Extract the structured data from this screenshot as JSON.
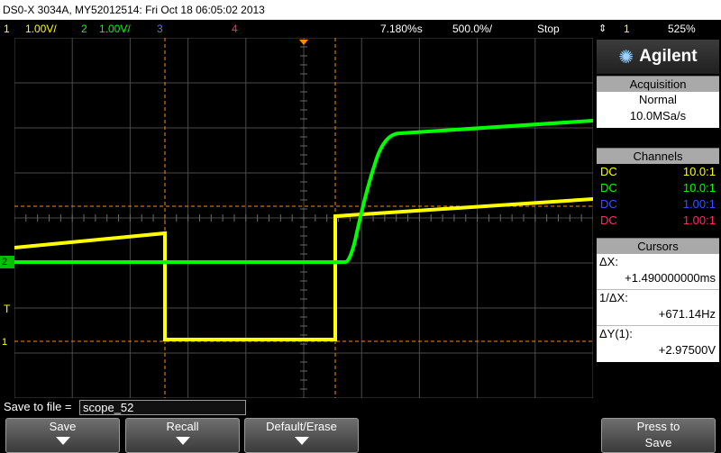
{
  "title": "DS0-X 3034A, MY52012514: Fri Oct 18 06:05:02 2013",
  "top": {
    "ch1_num": "1",
    "ch1_scale": "1.00V/",
    "ch2_num": "2",
    "ch2_scale": "1.00V/",
    "ch3_num": "3",
    "ch4_num": "4",
    "delay": "7.180%s",
    "timebase": "500.0%/",
    "state": "Stop",
    "trig_src": "1",
    "trig_level": "525%"
  },
  "brand": "Agilent",
  "acquisition": {
    "header": "Acquisition",
    "mode": "Normal",
    "rate": "10.0MSa/s"
  },
  "channels": {
    "header": "Channels",
    "rows": [
      {
        "coupling": "DC",
        "probe": "10.0:1",
        "color": "#ffff00"
      },
      {
        "coupling": "DC",
        "probe": "10.0:1",
        "color": "#00ff00"
      },
      {
        "coupling": "DC",
        "probe": "1.00:1",
        "color": "#3355ff"
      },
      {
        "coupling": "DC",
        "probe": "1.00:1",
        "color": "#ff2a6a"
      }
    ]
  },
  "cursors": {
    "header": "Cursors",
    "dx_label": "ΔX:",
    "dx_value": "+1.490000000ms",
    "inv_label": "1/ΔX:",
    "inv_value": "+671.14Hz",
    "dy_label": "ΔY(1):",
    "dy_value": "+2.97500V"
  },
  "markers": {
    "ch2": "2",
    "trig": "T",
    "ch1": "1"
  },
  "save": {
    "label": "Save to file =",
    "filename": "scope_52"
  },
  "softkeys": {
    "save": "Save",
    "recall": "Recall",
    "default_erase": "Default/Erase",
    "press_to": "Press to",
    "press_save": "Save"
  },
  "colors": {
    "ch1": "#ffff00",
    "ch2": "#00ff00",
    "ch3": "#3355ff",
    "ch4": "#ff2a6a",
    "cursor": "#ff8c00",
    "grid": "#5a5a5a"
  }
}
